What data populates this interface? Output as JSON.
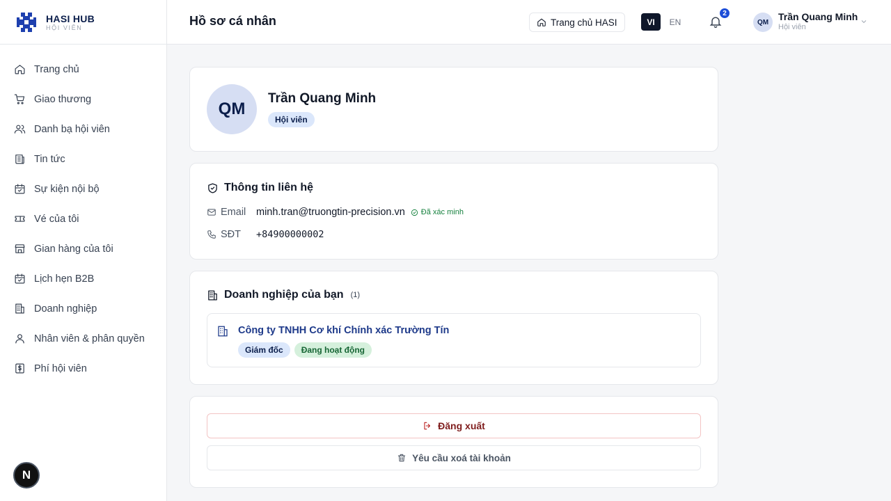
{
  "brand": {
    "name": "HASI HUB",
    "subtitle": "HỘI VIÊN"
  },
  "sidebar": {
    "items": [
      {
        "label": "Trang chủ",
        "icon": "home-icon"
      },
      {
        "label": "Giao thương",
        "icon": "cart-icon"
      },
      {
        "label": "Danh bạ hội viên",
        "icon": "users-icon"
      },
      {
        "label": "Tin tức",
        "icon": "newspaper-icon"
      },
      {
        "label": "Sự kiện nội bộ",
        "icon": "calendar-check-icon"
      },
      {
        "label": "Vé của tôi",
        "icon": "ticket-icon"
      },
      {
        "label": "Gian hàng của tôi",
        "icon": "store-icon"
      },
      {
        "label": "Lịch hẹn B2B",
        "icon": "calendar-check-icon"
      },
      {
        "label": "Doanh nghiệp",
        "icon": "building-icon"
      },
      {
        "label": "Nhân viên & phân quyền",
        "icon": "user-icon"
      },
      {
        "label": "Phí hội viên",
        "icon": "dollar-icon"
      }
    ],
    "fab_label": "N"
  },
  "header": {
    "title": "Hồ sơ cá nhân",
    "home_button": "Trang chủ HASI",
    "lang_vi": "VI",
    "lang_en": "EN",
    "notification_count": "2",
    "user_initials": "QM",
    "user_name": "Trần Quang Minh",
    "user_role": "Hội viên"
  },
  "profile": {
    "initials": "QM",
    "name": "Trần Quang Minh",
    "role": "Hội viên"
  },
  "contact": {
    "title": "Thông tin liên hệ",
    "email_label": "Email",
    "email": "minh.tran@truongtin-precision.vn",
    "email_status": "Đã xác minh",
    "phone_label": "SĐT",
    "phone": "+84900000002"
  },
  "company": {
    "title": "Doanh nghiệp của bạn",
    "count": "(1)",
    "items": [
      {
        "name": "Công ty TNHH Cơ khí Chính xác Trường Tín",
        "role": "Giám đốc",
        "status": "Đang hoạt động"
      }
    ]
  },
  "actions": {
    "logout": "Đăng xuất",
    "delete_account": "Yêu cầu xoá tài khoản"
  },
  "colors": {
    "brand": "#0b1e4b",
    "accent": "#1d4ed8",
    "success": "#15803d",
    "danger": "#b91c1c"
  }
}
